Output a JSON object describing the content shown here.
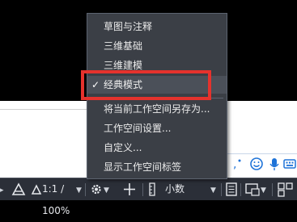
{
  "workspace_menu": {
    "items": [
      {
        "label": "草图与注释",
        "checked": false
      },
      {
        "label": "三维基础",
        "checked": false
      },
      {
        "label": "三维建模",
        "checked": false
      },
      {
        "label": "经典模式",
        "checked": true
      },
      {
        "label": "将当前工作空间另存为...",
        "checked": false
      },
      {
        "label": "工作空间设置...",
        "checked": false
      },
      {
        "label": "自定义...",
        "checked": false
      },
      {
        "label": "显示工作空间标签",
        "checked": false
      }
    ],
    "check_mark": "✓"
  },
  "status_bar": {
    "annotation_scale": "1:1 / 100%",
    "units_label": "小数"
  },
  "ime_toolbar": {
    "icons": [
      "comma-icon",
      "emoji-icon",
      "microphone-icon",
      "keyboard-icon"
    ]
  },
  "colors": {
    "menu_bg": "#3b3f46",
    "highlight_border": "#e5322d",
    "status_bar_bg": "#2b2f38",
    "ime_icon": "#1e73d8"
  }
}
